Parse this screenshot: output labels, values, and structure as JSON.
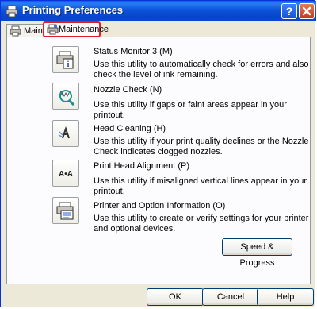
{
  "window": {
    "title": "Printing Preferences",
    "help_button": "?",
    "accent": "#0a5fe3"
  },
  "tabs": [
    {
      "label": "Main",
      "icon": "printer-icon"
    },
    {
      "label": "Maintenance",
      "icon": "maintenance-printer-icon",
      "selected": true
    }
  ],
  "utilities": [
    {
      "title": "Status Monitor 3 (M)",
      "desc": "Use this utility to automatically check for errors and also check the level of ink remaining.",
      "icon": "status-monitor-icon"
    },
    {
      "title": "Nozzle Check (N)",
      "desc": "Use this utility if gaps or faint areas appear in your printout.",
      "icon": "nozzle-check-icon"
    },
    {
      "title": "Head Cleaning (H)",
      "desc": "Use this utility if your print quality declines or the Nozzle Check indicates clogged nozzles.",
      "icon": "head-cleaning-icon"
    },
    {
      "title": "Print Head Alignment (P)",
      "desc": "Use this utility if misaligned vertical lines appear in your printout.",
      "icon": "head-alignment-icon",
      "icon_text": "A•A"
    },
    {
      "title": "Printer and Option Information (O)",
      "desc": "Use this utility to create or verify settings for your printer and optional devices.",
      "icon": "printer-info-icon"
    }
  ],
  "buttons": {
    "speed": "Speed & Progress",
    "ok": "OK",
    "cancel": "Cancel",
    "help": "Help"
  },
  "highlight_color": "#e11c24"
}
